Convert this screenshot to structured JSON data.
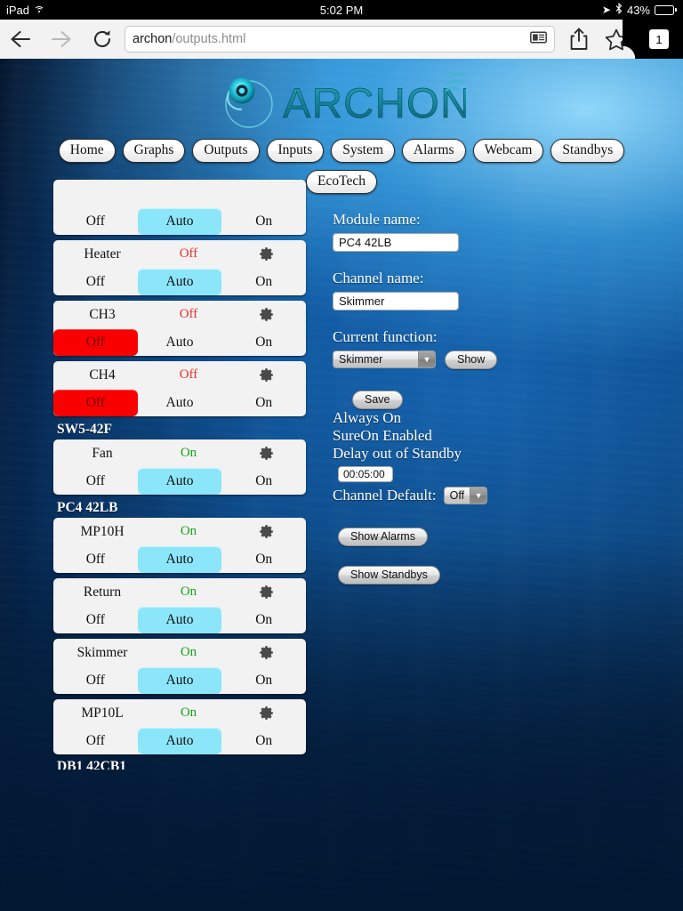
{
  "statusbar": {
    "device": "iPad",
    "wifi_icon": "wifi-icon",
    "time": "5:02 PM",
    "location_icon": "location-arrow-icon",
    "bluetooth_icon": "bluetooth-icon",
    "battery_percent": "43%",
    "battery_level": 43
  },
  "browser": {
    "back_icon": "back-arrow-icon",
    "forward_icon": "forward-arrow-icon",
    "reload_icon": "reload-icon",
    "url_host": "archon",
    "url_path": "/outputs.html",
    "reader_icon": "reader-view-icon",
    "share_icon": "share-icon",
    "bookmark_icon": "star-bookmark-icon",
    "tab_count": "1"
  },
  "logo": {
    "wordmark": "ARCHON",
    "mark_icon": "archon-swirl-icon",
    "signal_icon": "signal-arcs-icon"
  },
  "nav": {
    "row1": [
      {
        "label": "Home"
      },
      {
        "label": "Graphs"
      },
      {
        "label": "Outputs"
      },
      {
        "label": "Inputs"
      },
      {
        "label": "System"
      },
      {
        "label": "Alarms"
      },
      {
        "label": "Webcam"
      },
      {
        "label": "Standbys"
      }
    ],
    "row2": [
      {
        "label": "EcoTech"
      }
    ]
  },
  "outputs": {
    "mode_labels": {
      "off": "Off",
      "auto": "Auto",
      "on": "On"
    },
    "gear_icon": "gear-icon",
    "groups": [
      {
        "label": "",
        "clipped": true,
        "channels": [
          {
            "name": "",
            "state": "",
            "state_kind": "none",
            "selected": "auto",
            "clipped_top": true
          }
        ]
      },
      {
        "label": "",
        "channels": [
          {
            "name": "Heater",
            "state": "Off",
            "state_kind": "off",
            "selected": "auto"
          },
          {
            "name": "CH3",
            "state": "Off",
            "state_kind": "off",
            "selected": "off"
          },
          {
            "name": "CH4",
            "state": "Off",
            "state_kind": "off",
            "selected": "off"
          }
        ]
      },
      {
        "label": "SW5-42F",
        "channels": [
          {
            "name": "Fan",
            "state": "On",
            "state_kind": "on",
            "selected": "auto"
          }
        ]
      },
      {
        "label": "PC4 42LB",
        "channels": [
          {
            "name": "MP10H",
            "state": "On",
            "state_kind": "on",
            "selected": "auto"
          },
          {
            "name": "Return",
            "state": "On",
            "state_kind": "on",
            "selected": "auto"
          },
          {
            "name": "Skimmer",
            "state": "On",
            "state_kind": "on",
            "selected": "auto"
          },
          {
            "name": "MP10L",
            "state": "On",
            "state_kind": "on",
            "selected": "auto"
          }
        ]
      },
      {
        "label": "DB1 42CB1",
        "clipped_bottom": true,
        "channels": []
      }
    ]
  },
  "form": {
    "module_name_label": "Module name:",
    "module_name_value": "PC4 42LB",
    "channel_name_label": "Channel name:",
    "channel_name_value": "Skimmer",
    "current_function_label": "Current function:",
    "current_function_value": "Skimmer",
    "show_button": "Show",
    "save_button": "Save",
    "status_always_on": "Always On",
    "status_sureon": "SureOn Enabled",
    "status_delay": "Delay out of Standby",
    "delay_value": "00:05:00",
    "channel_default_label": "Channel Default:",
    "channel_default_value": "Off",
    "show_alarms_button": "Show Alarms",
    "show_standbys_button": "Show Standbys",
    "dropdown_icon": "chevron-down-icon"
  },
  "colors": {
    "auto_selected": "#8ce6fa",
    "off_selected": "#fb0000",
    "state_on": "#18a11c",
    "state_off": "#e8302a",
    "card_bg": "#f2f2f2"
  }
}
